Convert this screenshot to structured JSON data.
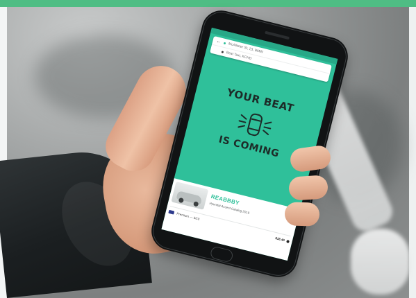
{
  "scene": {
    "colors": {
      "top_bar": "#4fbd84",
      "app_teal": "#2fc09a"
    }
  },
  "app": {
    "search": {
      "pickup": "McAllister St, 23, BMW",
      "destination": "Beat Taxi, KCHD"
    },
    "hero": {
      "line1": "YOUR BEAT",
      "line2": "IS COMING",
      "icon": "car-arriving-icon"
    },
    "ride": {
      "title": "REABBBY",
      "subtitle": "Hyundai Accent Catalog 2019",
      "payment_label": "Premium — 5/10",
      "price": "$18.40",
      "icon": "location-pin-icon"
    }
  }
}
